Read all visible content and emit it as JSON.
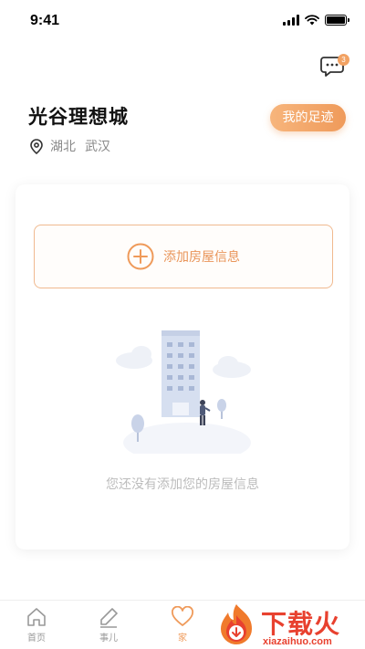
{
  "status_bar": {
    "time": "9:41"
  },
  "header": {
    "community_name": "光谷理想城",
    "location": {
      "province": "湖北",
      "city": "武汉"
    },
    "footprint_button": "我的足迹",
    "message_badge": "3"
  },
  "card": {
    "add_house_label": "添加房屋信息",
    "empty_text": "您还没有添加您的房屋信息"
  },
  "tabbar": {
    "tabs": [
      {
        "label": "首页",
        "icon": "home-icon",
        "active": false
      },
      {
        "label": "事儿",
        "icon": "pencil-icon",
        "active": false
      },
      {
        "label": "家",
        "icon": "heart-icon",
        "active": true
      }
    ]
  },
  "watermark": {
    "brand": "下载火",
    "url": "xiazaihuo.com"
  },
  "colors": {
    "accent": "#ef9a5a",
    "accent_light": "#f7b57c",
    "muted": "#bcbcbc",
    "watermark": "#e8412f"
  }
}
